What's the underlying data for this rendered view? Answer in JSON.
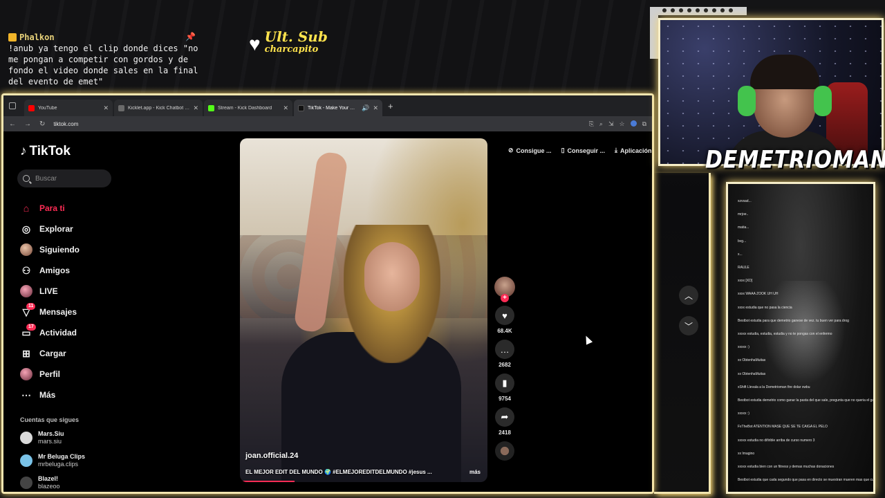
{
  "overlay": {
    "chat_user": "Phalkon",
    "chat_message": "!anub ya tengo el clip donde dices \"no me pongan a competir con gordos y de fondo el video donde sales en la final del evento de emet\"",
    "ult_sub_title": "Ult. Sub",
    "ult_sub_name": "charcapito",
    "streamer_name": "DEMETRIOMAN"
  },
  "browser": {
    "tabs": [
      {
        "label": "YouTube",
        "color": "#ff0000",
        "active": false
      },
      {
        "label": "Kicklet.app - Kick Chatbot and",
        "color": "#6a6a6a",
        "active": false
      },
      {
        "label": "Stream - Kick Dashboard",
        "color": "#53fc18",
        "active": false
      },
      {
        "label": "TikTok - Make Your Day",
        "color": "#111111",
        "active": true
      }
    ],
    "url": "tiktok.com"
  },
  "tiktok": {
    "logo": "TikTok",
    "search_placeholder": "Buscar",
    "nav": [
      {
        "label": "Para ti",
        "icon": "home-icon",
        "active": true
      },
      {
        "label": "Explorar",
        "icon": "compass-icon"
      },
      {
        "label": "Siguiendo",
        "icon": "following-avatar-icon"
      },
      {
        "label": "Amigos",
        "icon": "friends-icon"
      },
      {
        "label": "LIVE",
        "icon": "live-avatar-icon"
      },
      {
        "label": "Mensajes",
        "icon": "messages-icon",
        "badge": "11"
      },
      {
        "label": "Actividad",
        "icon": "activity-icon",
        "badge": "17"
      },
      {
        "label": "Cargar",
        "icon": "upload-icon"
      },
      {
        "label": "Perfil",
        "icon": "profile-avatar-icon"
      },
      {
        "label": "Más",
        "icon": "more-icon"
      }
    ],
    "following_title": "Cuentas que sigues",
    "following": [
      {
        "name": "Mars.Siu",
        "user": "mars.siu"
      },
      {
        "name": "Mr Beluga Clips",
        "user": "mrbeluga.clips"
      },
      {
        "name": "Blazel!",
        "user": "blazeoo"
      }
    ],
    "top_pills": [
      "Consigue ...",
      "Conseguir ...",
      "Aplicación"
    ],
    "video": {
      "username": "joan.official.24",
      "description": "EL MEJOR EDIT DEL MUNDO 🌍 #ELMEJOREDITDELMUNDO #jesus ...",
      "more": "más",
      "progress": 0.22
    },
    "actions": {
      "likes": "68.4K",
      "comments": "2682",
      "saves": "9754",
      "shares": "2418"
    }
  },
  "right_chat": {
    "lines": [
      "xzvsad...",
      "mrjoe..",
      "matia...",
      "bvg...",
      "x...",
      "RAULE",
      "xxxx  [XD]",
      "xxxx  WAAA ZOOK UH UH",
      "xxxx  estudia que no pasa la ciencia",
      "Bestbot  estudia para que demetrio ganese de vez. tu buen ver para drog",
      "xxxxx  estudia, estudia, estudia y no te pongas con el enfermo",
      "xxxxx  :)",
      "xx  ObtenhaMuitas",
      "xx  ObtenhaMuitas",
      "xShift  Llevala a la Demetrioman fire dolar xwbu",
      "Bestbot  estudia demetrio como ganar la pasta del que sale, pregunta que no queria el ganador",
      "xxxxx  :)",
      "FxTheBot  ATENTION MASE QUE SE TE CAIGA EL PELO",
      "xxxxx  estudia no difirible arriba de curso numero 3",
      "xx  Imagino",
      "xxxxx  estudia bien con un fitness y demas muchas donaciones",
      "Bestbot  estudia que cada segundo que pasa en directo se muestran mueren mas que cuando lo ves jugar"
    ]
  }
}
